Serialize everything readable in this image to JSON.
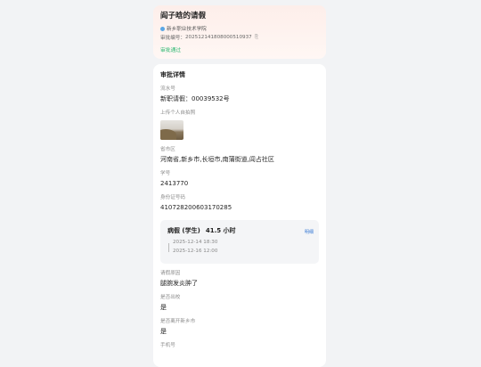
{
  "header": {
    "title": "阎子晗的请假",
    "org": "新乡职业技术学院",
    "approval_no_label": "审批编号：",
    "approval_no": "202512141808000510937",
    "status": "审批通过"
  },
  "detail": {
    "section_title": "审批详情",
    "fields_top": [
      {
        "label": "流水号",
        "value": "新职请假：00039532号"
      }
    ],
    "photo_label": "上传个人自拍照",
    "fields_mid": [
      {
        "label": "省市区",
        "value": "河南省,新乡市,长垣市,南蒲街道,闾占社区"
      },
      {
        "label": "学号",
        "value": "2413770"
      },
      {
        "label": "身份证号码",
        "value": "410728200603170285"
      }
    ],
    "leave": {
      "type": "病假 (学生)",
      "duration": "41.5 小时",
      "detail_link": "明细",
      "start": "2025-12-14 18:30",
      "end": "2025-12-16 12:00"
    },
    "fields_bottom": [
      {
        "label": "请假原因",
        "value": "腿腕发炎肿了"
      },
      {
        "label": "是否出校",
        "value": "是"
      },
      {
        "label": "是否离开新乡市",
        "value": "是"
      },
      {
        "label": "手机号",
        "value": ""
      }
    ]
  }
}
